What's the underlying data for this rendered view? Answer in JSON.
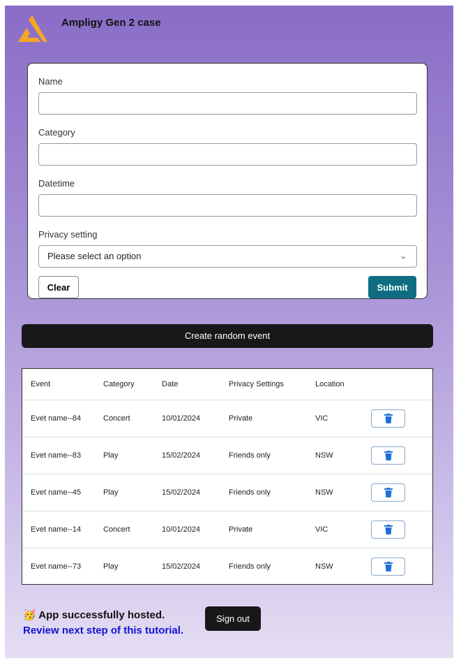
{
  "header": {
    "title": "Ampligy Gen 2 case",
    "logo_color": "#f5a623"
  },
  "form": {
    "name_label": "Name",
    "name_value": "",
    "category_label": "Category",
    "category_value": "",
    "datetime_label": "Datetime",
    "datetime_value": "",
    "privacy_label": "Privacy setting",
    "privacy_value": "Please select an option",
    "clear_label": "Clear",
    "submit_label": "Submit",
    "submit_color": "#0e6d82"
  },
  "create_label": "Create random event",
  "table": {
    "headers": [
      "Event",
      "Category",
      "Date",
      "Privacy Settings",
      "Location"
    ],
    "rows": [
      [
        "Evet name--84",
        "Concert",
        "10/01/2024",
        "Private",
        "VIC"
      ],
      [
        "Evet name--83",
        "Play",
        "15/02/2024",
        "Friends only",
        "NSW"
      ],
      [
        "Evet name--45",
        "Play",
        "15/02/2024",
        "Friends only",
        "NSW"
      ],
      [
        "Evet name--14",
        "Concert",
        "10/01/2024",
        "Private",
        "VIC"
      ],
      [
        "Evet name--73",
        "Play",
        "15/02/2024",
        "Friends only",
        "NSW"
      ]
    ],
    "delete_icon": "trash-icon"
  },
  "footer": {
    "status": "🥳 App successfully hosted.",
    "link": "Review next step of this tutorial.",
    "signout_label": "Sign out"
  }
}
